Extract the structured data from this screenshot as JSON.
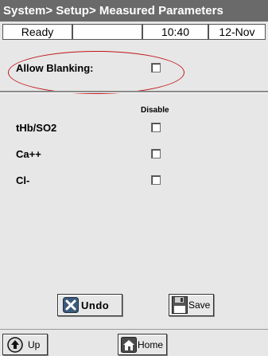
{
  "title": "System> Setup> Measured Parameters",
  "status": {
    "state": "Ready",
    "blank": "",
    "time": "10:40",
    "date": "12-Nov"
  },
  "blanking": {
    "label": "Allow Blanking:",
    "checked": false
  },
  "parameters": {
    "column_header": "Disable",
    "items": [
      {
        "label": "tHb/SO2",
        "disabled": false
      },
      {
        "label": "Ca++",
        "disabled": false
      },
      {
        "label": "Cl-",
        "disabled": false
      }
    ]
  },
  "actions": {
    "undo_label": "Undo",
    "save_label": "Save"
  },
  "footer": {
    "up_label": "Up",
    "home_label": "Home"
  },
  "colors": {
    "titlebar": "#6a6a6a",
    "background": "#e7e7e7",
    "highlight_ellipse": "#c0161a"
  },
  "icons": {
    "undo": "x-icon",
    "save": "floppy-disk-icon",
    "up": "up-arrow-icon",
    "home": "home-icon"
  }
}
